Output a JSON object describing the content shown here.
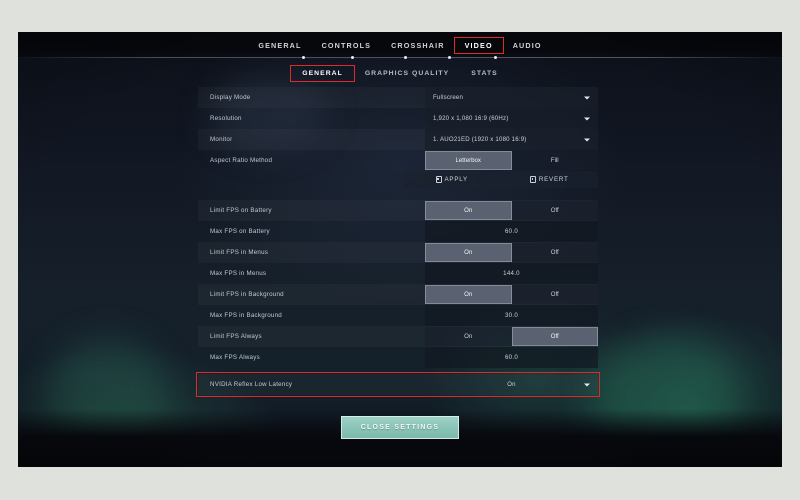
{
  "main_nav": {
    "tabs": [
      {
        "label": "GENERAL",
        "selected": false,
        "highlighted": false
      },
      {
        "label": "CONTROLS",
        "selected": false,
        "highlighted": false
      },
      {
        "label": "CROSSHAIR",
        "selected": false,
        "highlighted": false
      },
      {
        "label": "VIDEO",
        "selected": true,
        "highlighted": true
      },
      {
        "label": "AUDIO",
        "selected": false,
        "highlighted": false
      }
    ]
  },
  "sub_nav": {
    "tabs": [
      {
        "label": "GENERAL",
        "selected": true,
        "highlighted": true
      },
      {
        "label": "GRAPHICS QUALITY",
        "selected": false,
        "highlighted": false
      },
      {
        "label": "STATS",
        "selected": false,
        "highlighted": false
      }
    ]
  },
  "settings": {
    "display_mode": {
      "label": "Display Mode",
      "value": "Fullscreen",
      "icon": "chevron-down-icon"
    },
    "resolution": {
      "label": "Resolution",
      "value": "1,920 x 1,080 16:9 (60Hz)",
      "icon": "chevron-down-icon"
    },
    "monitor": {
      "label": "Monitor",
      "value": "1. AUO21ED (1920 x  1080 16:9)",
      "icon": "chevron-down-icon"
    },
    "aspect_ratio_method": {
      "label": "Aspect Ratio Method",
      "options": [
        "Letterbox",
        "Fill"
      ],
      "selected": "Letterbox"
    },
    "apply": {
      "label": "APPLY",
      "icon": "keycap-icon"
    },
    "revert": {
      "label": "REVERT",
      "icon": "keycap-icon"
    },
    "limit_fps_battery": {
      "label": "Limit FPS on Battery",
      "options": [
        "On",
        "Off"
      ],
      "selected": "On"
    },
    "max_fps_battery": {
      "label": "Max FPS on Battery",
      "value": "60.0"
    },
    "limit_fps_menus": {
      "label": "Limit FPS in Menus",
      "options": [
        "On",
        "Off"
      ],
      "selected": "On"
    },
    "max_fps_menus": {
      "label": "Max FPS in Menus",
      "value": "144.0"
    },
    "limit_fps_background": {
      "label": "Limit FPS in Background",
      "options": [
        "On",
        "Off"
      ],
      "selected": "On"
    },
    "max_fps_background": {
      "label": "Max FPS in Background",
      "value": "30.0"
    },
    "limit_fps_always": {
      "label": "Limit FPS Always",
      "options": [
        "On",
        "Off"
      ],
      "selected": "Off"
    },
    "max_fps_always": {
      "label": "Max FPS Always",
      "value": "60.0"
    },
    "nvidia_reflex": {
      "label": "NVIDIA Reflex Low Latency",
      "value": "On",
      "icon": "chevron-down-icon",
      "highlighted": true
    }
  },
  "footer": {
    "close_label": "CLOSE SETTINGS"
  },
  "colors": {
    "highlight_red": "#e02a2a",
    "close_button": "#8cc6ba",
    "page_border": "#dfe2dc",
    "selected_segment": "#5a6170"
  }
}
